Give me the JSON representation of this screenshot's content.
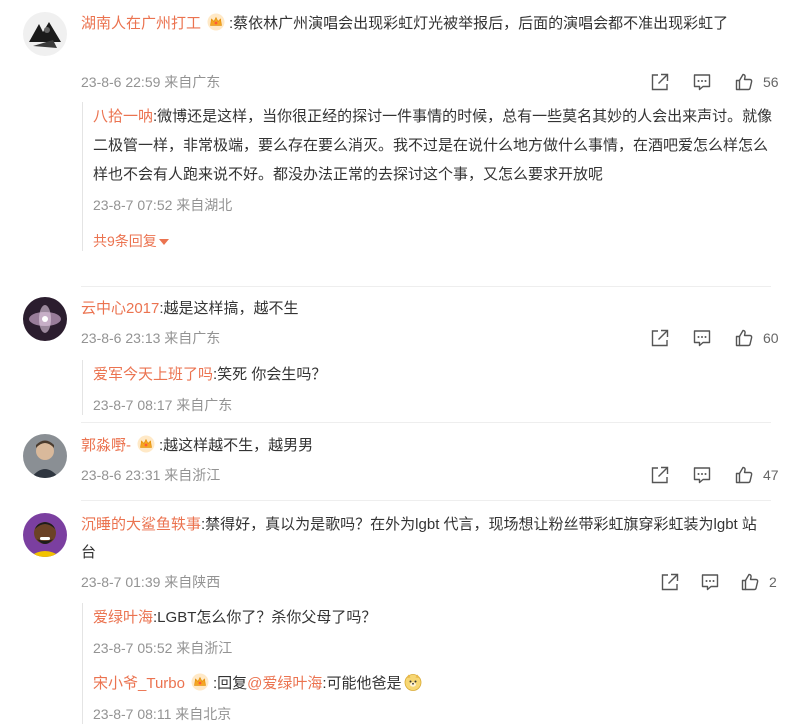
{
  "comments": [
    {
      "user": "湖南人在广州打工",
      "has_crown": true,
      "text": ":蔡依林广州演唱会出现彩虹灯光被举报后，后面的演唱会都不准出现彩虹了",
      "meta": "23-8-6 22:59 来自广东",
      "likes": "56",
      "replies": [
        {
          "user": "八拾一呐",
          "text": ":微博还是这样，当你很正经的探讨一件事情的时候，总有一些莫名其妙的人会出来声讨。就像二极管一样，非常极端，要么存在要么消灭。我不过是在说什么地方做什么事情，在酒吧爱怎么样怎么样也不会有人跑来说不好。都没办法正常的去探讨这个事，又怎么要求开放呢",
          "meta": "23-8-7 07:52 来自湖北"
        }
      ],
      "more_label": "共9条回复"
    },
    {
      "user": "云中心2017",
      "has_crown": false,
      "text": ":越是这样搞，越不生",
      "meta": "23-8-6 23:13 来自广东",
      "likes": "60",
      "replies": [
        {
          "user": "爱军今天上班了吗",
          "text": ":笑死 你会生吗？",
          "meta": "23-8-7 08:17 来自广东"
        }
      ]
    },
    {
      "user": "郭淼嘢-",
      "has_crown": true,
      "text": ":越这样越不生，越男男",
      "meta": "23-8-6 23:31 来自浙江",
      "likes": "47"
    },
    {
      "user": "沉睡的大鲨鱼轶事",
      "has_crown": false,
      "text": ":禁得好，真以为是歌吗？在外为lgbt 代言，现场想让粉丝带彩虹旗穿彩虹装为lgbt 站台",
      "meta": "23-8-7 01:39 来自陕西",
      "likes": "2",
      "replies": [
        {
          "user": "爱绿叶海",
          "text": ":LGBT怎么你了？杀你父母了吗？",
          "meta": "23-8-7 05:52 来自浙江"
        },
        {
          "user": "宋小爷_Turbo",
          "has_crown": true,
          "text_prefix": ":回复",
          "mention": "@爱绿叶海",
          "text_suffix": ":可能他爸是",
          "emoji": "doge-emoji",
          "meta": "23-8-7 08:11 来自北京"
        }
      ]
    }
  ],
  "icons": {
    "share": "share-icon",
    "comment": "comment-icon",
    "like": "like-icon",
    "crown": "crown-badge-icon"
  },
  "colors": {
    "username": "#eb7350",
    "meta": "#939393",
    "text": "#333333"
  }
}
